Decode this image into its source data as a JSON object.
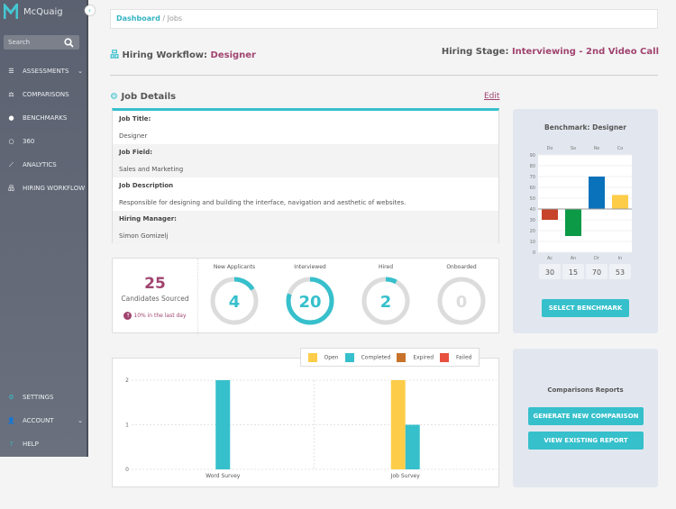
{
  "app": {
    "name": "McQuaig",
    "search_placeholder": "Search"
  },
  "sidebar": {
    "items": [
      {
        "label": "ASSESSMENTS",
        "icon": "list-check-icon",
        "expandable": true
      },
      {
        "label": "COMPARISONS",
        "icon": "scale-icon"
      },
      {
        "label": "BENCHMARKS",
        "icon": "compass-icon"
      },
      {
        "label": "360",
        "icon": "ring-icon"
      },
      {
        "label": "ANALYTICS",
        "icon": "line-chart-icon"
      },
      {
        "label": "HIRING WORKFLOW",
        "icon": "sitemap-icon"
      }
    ],
    "bottom": [
      {
        "label": "SETTINGS",
        "icon": "gear-icon"
      },
      {
        "label": "ACCOUNT",
        "icon": "user-icon",
        "expandable": true
      },
      {
        "label": "HELP",
        "icon": "help-icon"
      }
    ]
  },
  "breadcrumb": {
    "root": "Dashboard",
    "sep": " / ",
    "current": "Jobs"
  },
  "header": {
    "workflow_label": "Hiring Workflow: ",
    "workflow_value": "Designer",
    "stage_label": "Hiring Stage: ",
    "stage_value": "Interviewing - 2nd Video Call"
  },
  "job_details": {
    "title": "Job Details",
    "edit": "Edit",
    "fields": [
      {
        "label": "Job Title:",
        "value": "Designer"
      },
      {
        "label": "Job Field:",
        "value": "Sales and Marketing"
      },
      {
        "label": "Job Description",
        "value": "Responsible for designing and building the interface, navigation and aesthetic of websites."
      },
      {
        "label": "Hiring Manager:",
        "value": "Simon Gomizelj"
      }
    ]
  },
  "stats": {
    "sourced": "25",
    "sourced_label": "Candidates Sourced",
    "trend": "10% in the last day",
    "donuts": [
      {
        "label": "New Applicants",
        "value": "4",
        "fraction": 0.16
      },
      {
        "label": "Interviewed",
        "value": "20",
        "fraction": 0.8
      },
      {
        "label": "Hired",
        "value": "2",
        "fraction": 0.08
      },
      {
        "label": "Onboarded",
        "value": "0",
        "fraction": 0
      }
    ]
  },
  "colors": {
    "accent": "#36c0cc",
    "brand": "#a0446f"
  },
  "benchmark": {
    "title": "Benchmark: Designer",
    "button": "SELECT BENCHMARK"
  },
  "comparisons": {
    "title": "Comparisons Reports",
    "generate": "GENERATE NEW COMPARISON",
    "view": "VIEW EXISTING REPORT"
  },
  "chart_data": [
    {
      "type": "bar",
      "top_labels": [
        "Do",
        "So",
        "Re",
        "Co"
      ],
      "categories": [
        "Ac",
        "An",
        "Dr",
        "In"
      ],
      "values": [
        30,
        15,
        70,
        53
      ],
      "baseline": 40,
      "ylim": [
        0,
        90
      ],
      "yticks": [
        "0",
        "10",
        "20",
        "30",
        "40",
        "50",
        "60",
        "70",
        "80",
        "90"
      ],
      "colors": [
        "#c7432a",
        "#0c9a47",
        "#0a72bb",
        "#fdcd4a"
      ],
      "value_labels": [
        "30",
        "15",
        "70",
        "53"
      ]
    },
    {
      "type": "bar",
      "categories": [
        "Word Survey",
        "Job Survey"
      ],
      "ylim": [
        0,
        2
      ],
      "yticks": [
        "0",
        "1",
        "2"
      ],
      "grid": true,
      "legend": "top-right",
      "series": [
        {
          "name": "Open",
          "color": "#fdcd4a",
          "values": [
            0,
            2
          ]
        },
        {
          "name": "Completed",
          "color": "#36c0cc",
          "values": [
            2,
            1
          ]
        },
        {
          "name": "Expired",
          "color": "#c8732b",
          "values": [
            0,
            0
          ]
        },
        {
          "name": "Failed",
          "color": "#e8503f",
          "values": [
            0,
            0
          ]
        }
      ]
    }
  ]
}
